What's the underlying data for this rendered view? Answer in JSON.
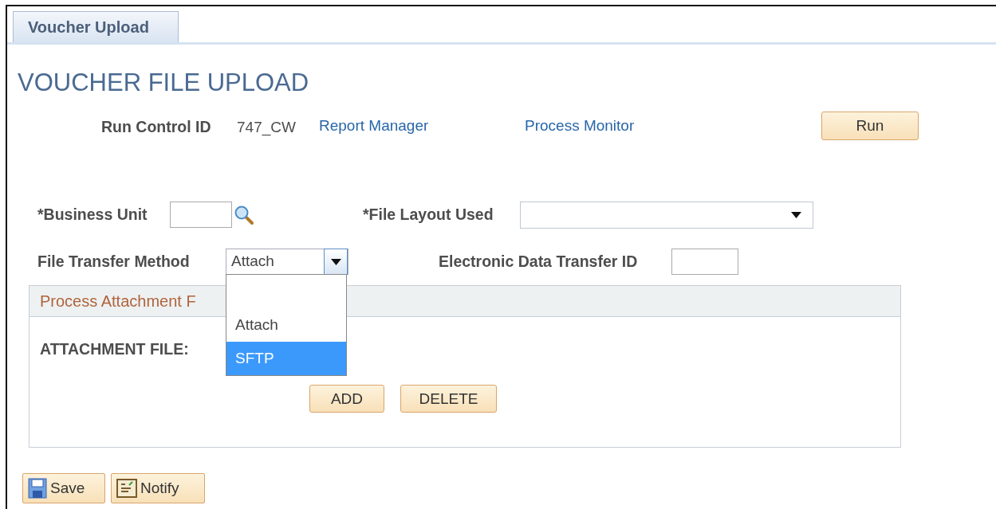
{
  "tabs": [
    {
      "label": "Voucher Upload",
      "selected": true
    }
  ],
  "page_title": "VOUCHER FILE UPLOAD",
  "run_control": {
    "label": "Run Control ID",
    "value": "747_CW",
    "links": [
      "Report Manager",
      "Process Monitor"
    ],
    "button": "Run"
  },
  "fields": [
    {
      "label": "*Business Unit",
      "kind": "lookup"
    },
    {
      "label": "*File Layout Used",
      "kind": "select"
    },
    {
      "label": "File Transfer Method",
      "kind": "select",
      "value": "Attach",
      "expanded": true,
      "options": [
        {
          "label": "Attach",
          "highlighted": false
        },
        {
          "label": "SFTP",
          "highlighted": true
        }
      ]
    },
    {
      "label": "Electronic Data Transfer ID",
      "kind": "text"
    }
  ],
  "panel": {
    "title": "Process Attachment F",
    "field_label": "ATTACHMENT FILE:",
    "buttons": [
      "ADD",
      "DELETE"
    ]
  },
  "toolbar": [
    {
      "label": "Save",
      "kind": "save"
    },
    {
      "label": "Notify",
      "kind": "notify"
    }
  ]
}
